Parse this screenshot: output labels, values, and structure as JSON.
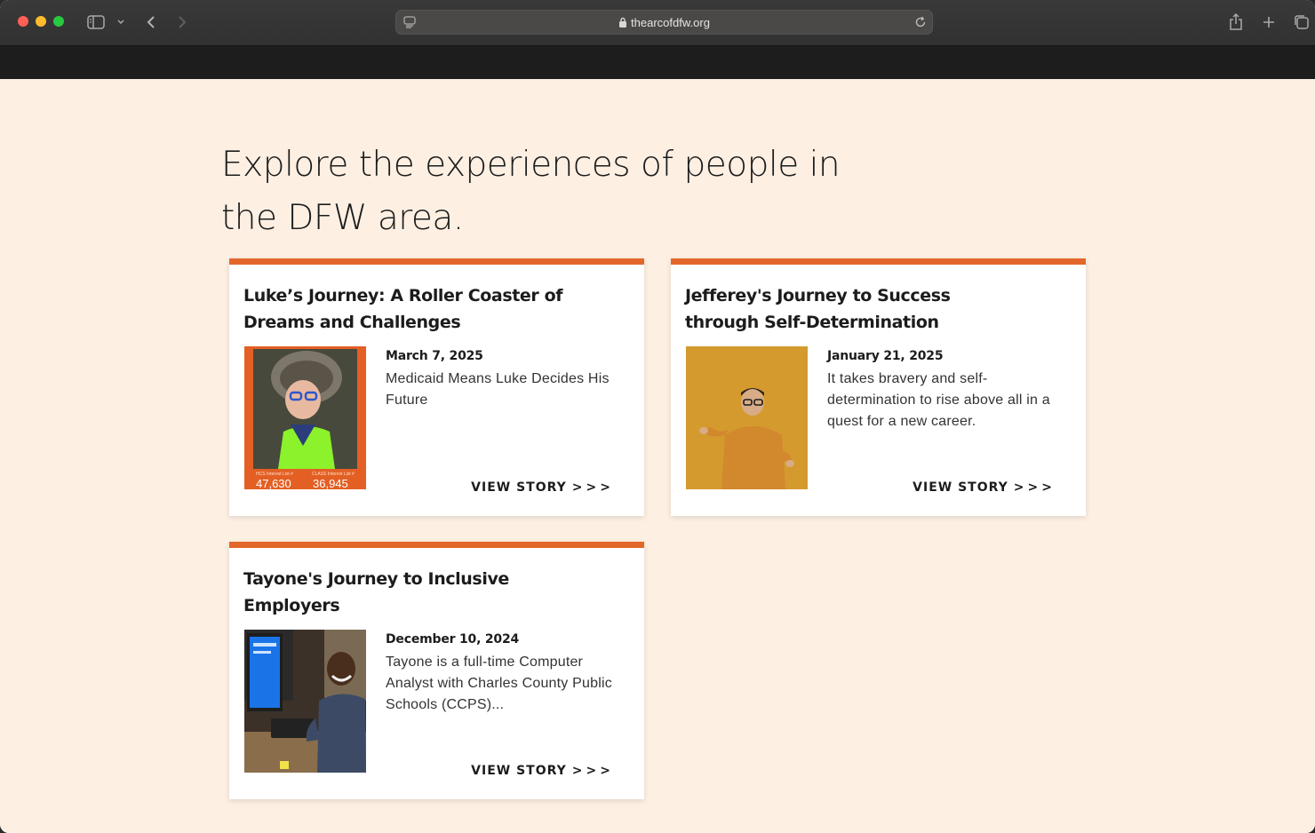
{
  "browser": {
    "url": "thearcofdfw.org"
  },
  "page": {
    "heading_line1": "Explore the experiences of people in",
    "heading_line2": "the DFW area."
  },
  "stories": [
    {
      "title_line1": "Luke’s Journey: A Roller Coaster of",
      "title_line2": "Dreams and Challenges",
      "date": "March 7, 2025",
      "description": "Medicaid Means Luke Decides His Future",
      "cta": "VIEW STORY",
      "image": {
        "stat_label_left": "HCS Interest List #",
        "stat_value_left": "47,630",
        "stat_label_right": "CLASS Interest List #",
        "stat_value_right": "36,945"
      }
    },
    {
      "title_line1": "Jefferey's Journey to Success",
      "title_line2": "through Self-Determination",
      "date": "January 21, 2025",
      "description": "It takes bravery and self-determination to rise above all in a quest for a new career.",
      "cta": "VIEW STORY"
    },
    {
      "title_line1": "Tayone's Journey to Inclusive",
      "title_line2": "Employers",
      "date": "December 10, 2024",
      "description": "Tayone is a full-time Computer Analyst with Charles County Public Schools (CCPS)...",
      "cta": "VIEW STORY"
    }
  ],
  "colors": {
    "accent": "#e3672a",
    "page_bg": "#fdf0e3"
  }
}
